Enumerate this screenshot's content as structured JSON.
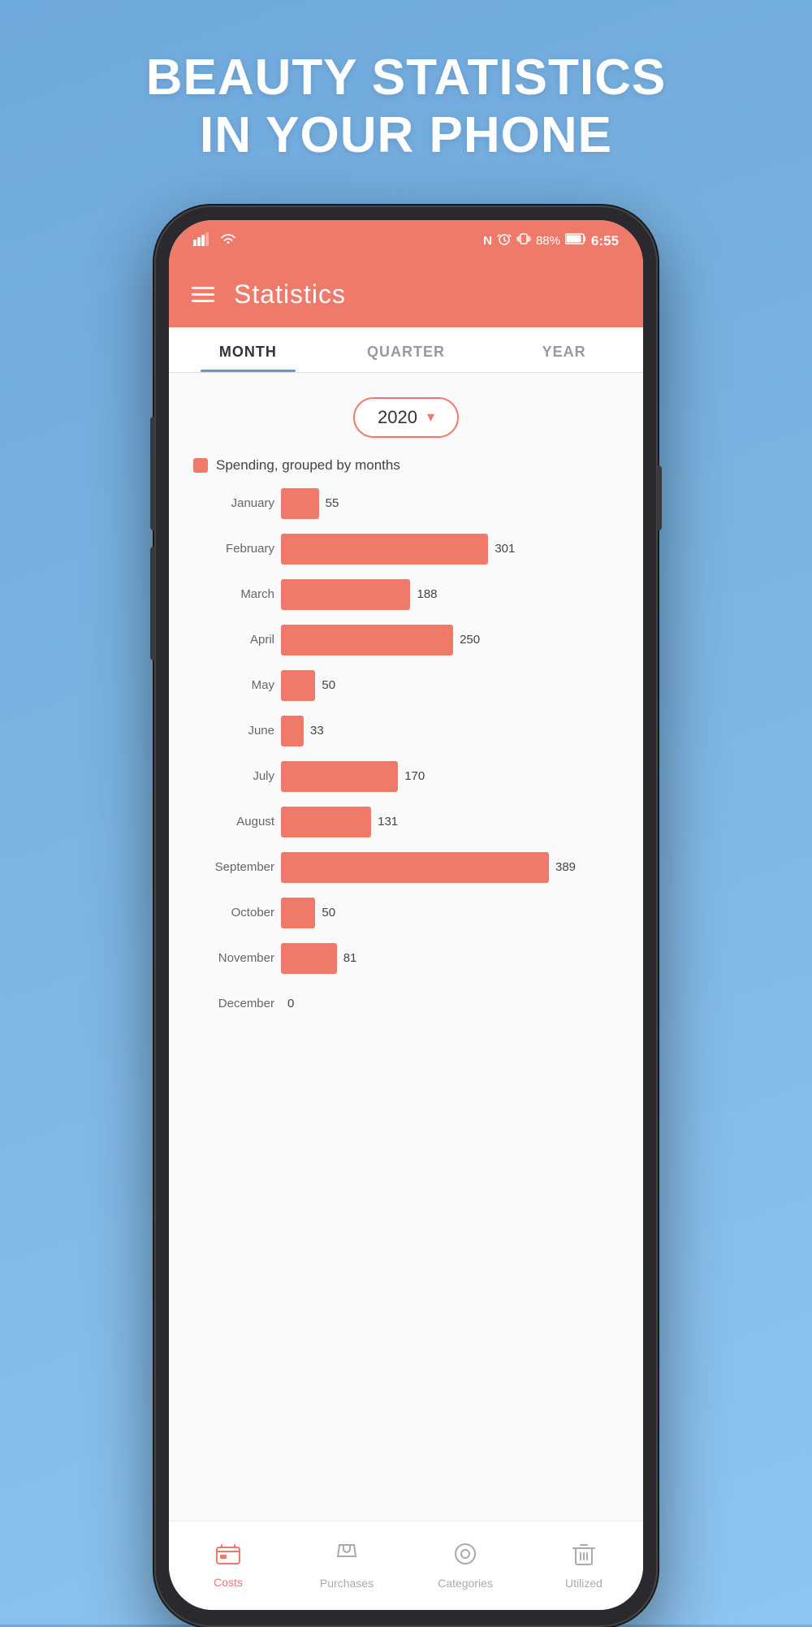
{
  "hero": {
    "title_line1": "BEAUTY STATISTICS",
    "title_line2": "IN YOUR PHONE"
  },
  "status_bar": {
    "signal": "📶",
    "wifi": "🛜",
    "nfc": "N",
    "alarm": "⏰",
    "vibrate": "📳",
    "battery_pct": "88%",
    "battery_icon": "🔋",
    "time": "6:55"
  },
  "app_header": {
    "title": "Statistics"
  },
  "tabs": [
    {
      "label": "MONTH",
      "active": true
    },
    {
      "label": "QUARTER",
      "active": false
    },
    {
      "label": "YEAR",
      "active": false
    }
  ],
  "year_selector": {
    "value": "2020"
  },
  "chart": {
    "legend": "Spending, grouped by months",
    "max_value": 389,
    "bars": [
      {
        "month": "January",
        "value": 55
      },
      {
        "month": "February",
        "value": 301
      },
      {
        "month": "March",
        "value": 188
      },
      {
        "month": "April",
        "value": 250
      },
      {
        "month": "May",
        "value": 50
      },
      {
        "month": "June",
        "value": 33
      },
      {
        "month": "July",
        "value": 170
      },
      {
        "month": "August",
        "value": 131
      },
      {
        "month": "September",
        "value": 389
      },
      {
        "month": "October",
        "value": 50
      },
      {
        "month": "November",
        "value": 81
      },
      {
        "month": "December",
        "value": 0
      }
    ]
  },
  "bottom_nav": [
    {
      "id": "costs",
      "label": "Costs",
      "icon": "💵",
      "active": true
    },
    {
      "id": "purchases",
      "label": "Purchases",
      "icon": "🛍",
      "active": false
    },
    {
      "id": "categories",
      "label": "Categories",
      "icon": "◎",
      "active": false
    },
    {
      "id": "utilized",
      "label": "Utilized",
      "icon": "🗑",
      "active": false
    }
  ]
}
